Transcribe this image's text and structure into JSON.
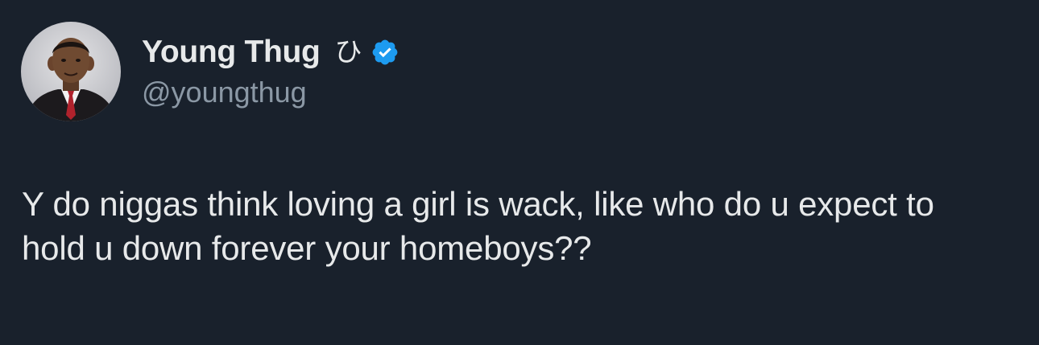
{
  "tweet": {
    "author": {
      "display_name": "Young Thug",
      "name_glyph": "ひ",
      "handle": "@youngthug",
      "verified": true,
      "avatar_icon": "profile-photo"
    },
    "text": "Y do niggas think loving a girl is wack, like who do u expect to hold u down forever your homeboys??"
  },
  "colors": {
    "background": "#19212c",
    "primary_text": "#e7e9ea",
    "secondary_text": "#8b98a5",
    "verified_badge": "#1d9bf0"
  }
}
